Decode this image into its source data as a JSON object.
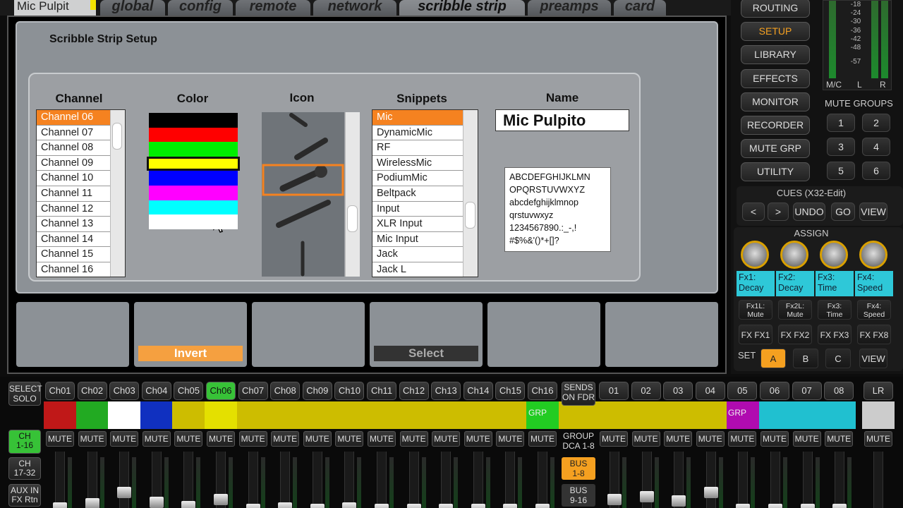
{
  "tabs": [
    {
      "label": "Mic Pulpit"
    },
    {
      "label": "global"
    },
    {
      "label": "config"
    },
    {
      "label": "remote"
    },
    {
      "label": "network"
    },
    {
      "label": "scribble strip"
    },
    {
      "label": "preamps"
    },
    {
      "label": "card"
    }
  ],
  "setup": {
    "title": "Scribble Strip Setup",
    "headers": {
      "channel": "Channel",
      "color": "Color",
      "icon": "Icon",
      "snippets": "Snippets",
      "name": "Name"
    },
    "channels": [
      "Channel 06",
      "Channel 07",
      "Channel 08",
      "Channel 09",
      "Channel 10",
      "Channel 11",
      "Channel 12",
      "Channel 13",
      "Channel 14",
      "Channel 15",
      "Channel 16"
    ],
    "colors": [
      "#000000",
      "#ff0000",
      "#00ee00",
      "#ffff00",
      "#0000ff",
      "#ff00ff",
      "#00ffff",
      "#ffffff"
    ],
    "icons": [
      "mic-icon",
      "handheld-mic-icon",
      "dynamic-mic-icon",
      "wireless-mic-icon",
      "podium-mic-icon"
    ],
    "snippets": [
      "Mic",
      "DynamicMic",
      "RF",
      "WirelessMic",
      "PodiumMic",
      "Beltpack",
      "Input",
      "XLR Input",
      "Mic Input",
      "Jack",
      "Jack L"
    ],
    "name_value": "Mic Pulpito",
    "charset": "ABCDEFGHIJKLMN\nOPQRSTUVWXYZ\nabcdefghijklmnop\nqrstuvwxyz\n1234567890.:_-,!\n#$%&'()*+[]?"
  },
  "fbuttons": {
    "invert": "Invert",
    "select": "Select"
  },
  "right": {
    "menu": [
      "ROUTING",
      "SETUP",
      "LIBRARY",
      "EFFECTS",
      "MONITOR",
      "RECORDER",
      "MUTE GRP",
      "UTILITY"
    ],
    "meter_ticks": [
      "-18",
      "-24",
      "-30",
      "-36",
      "-42",
      "-48",
      "-57"
    ],
    "meter_labels": [
      "M/C",
      "L",
      "R"
    ],
    "mute_groups_label": "MUTE GROUPS",
    "mute_groups": [
      "1",
      "2",
      "3",
      "4",
      "5",
      "6"
    ],
    "cues_label": "CUES (X32-Edit)",
    "cues": [
      "<",
      ">",
      "UNDO",
      "GO",
      "VIEW"
    ],
    "assign_label": "ASSIGN",
    "fx": [
      "Fx1:\nDecay",
      "Fx2:\nDecay",
      "Fx3:\nTime",
      "Fx4:\nSpeed"
    ],
    "fx_small": [
      "Fx1L:\nMute",
      "Fx2L:\nMute",
      "Fx3:\nTime",
      "Fx4:\nSpeed"
    ],
    "fx_buttons": [
      "FX FX1",
      "FX FX2",
      "FX FX3",
      "FX FX8"
    ],
    "set_label": "SET",
    "set_buttons": [
      "A",
      "B",
      "C",
      "VIEW"
    ]
  },
  "bottom": {
    "select_solo": "SELECT\nSOLO",
    "channels": [
      "Ch01",
      "Ch02",
      "Ch03",
      "Ch04",
      "Ch05",
      "Ch06",
      "Ch07",
      "Ch08",
      "Ch09",
      "Ch10",
      "Ch11",
      "Ch12",
      "Ch13",
      "Ch14",
      "Ch15",
      "Ch16"
    ],
    "sends_on_fdr": "SENDS\nON FDR",
    "buses": [
      "01",
      "02",
      "03",
      "04",
      "05",
      "06",
      "07",
      "08"
    ],
    "lr": "LR",
    "mute": "MUTE",
    "group_dca": "GROUP\nDCA 1-8",
    "bus18": "BUS\n1-8",
    "bus916": "BUS\n9-16",
    "ch116": "CH\n1-16",
    "ch1732": "CH\n17-32",
    "auxin": "AUX IN\nFX Rtn",
    "grp": "GRP"
  }
}
